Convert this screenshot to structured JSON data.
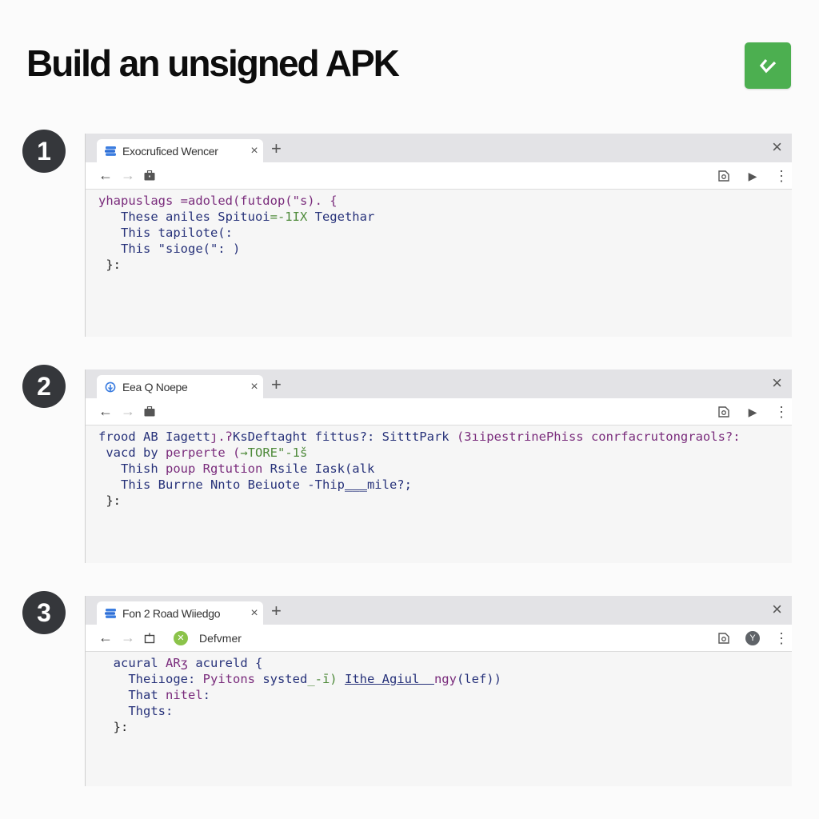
{
  "header": {
    "title": "Build an unsigned APK",
    "done_icon": "checkmark-icon",
    "accent_color": "#4caf50"
  },
  "steps": [
    {
      "number": "1",
      "tab": {
        "title": "Exocruficed Wencer",
        "favicon": "stack-icon"
      },
      "toolbar": {
        "right_icons": [
          "extension-icon",
          "play-icon",
          "kebab-menu-icon"
        ]
      },
      "code": [
        [
          {
            "t": "yhapuslags ",
            "c": "c-purple"
          },
          {
            "t": "=adoled(futdop(\"s). {",
            "c": "c-purple"
          }
        ],
        [
          {
            "t": "   These aniles Spituoi",
            "c": "c-blue"
          },
          {
            "t": "=-1IX",
            "c": "c-green"
          },
          {
            "t": " Tegethar",
            "c": "c-blue"
          }
        ],
        [
          {
            "t": "   This tapilote(:",
            "c": "c-blue"
          }
        ],
        [
          {
            "t": "   This \"sioge(\": )",
            "c": "c-blue"
          }
        ],
        [
          {
            "t": " }:",
            "c": "c-dark"
          }
        ]
      ]
    },
    {
      "number": "2",
      "tab": {
        "title": "Eea Q Noepe",
        "favicon": "globe-icon"
      },
      "toolbar": {
        "right_icons": [
          "extension-icon",
          "play-icon",
          "kebab-menu-icon"
        ]
      },
      "code": [
        [
          {
            "t": "frood AB ",
            "c": "c-blue"
          },
          {
            "t": "Iagett",
            "c": "c-blue"
          },
          {
            "t": "ȷ.ʔ",
            "c": "c-purple"
          },
          {
            "t": "KsDeftaght fittus?: SitttPark ",
            "c": "c-blue"
          },
          {
            "t": "(3ıipestrinePhiss conrfacrutongraols?:",
            "c": "c-purple"
          }
        ],
        [
          {
            "t": " vacd by ",
            "c": "c-blue"
          },
          {
            "t": "perperte (",
            "c": "c-purple"
          },
          {
            "t": "→TORE\"-1š",
            "c": "c-green"
          }
        ],
        [
          {
            "t": "   Thish ",
            "c": "c-blue"
          },
          {
            "t": "poup Rgtution",
            "c": "c-purple"
          },
          {
            "t": " Rsile Iask(alk",
            "c": "c-blue"
          }
        ],
        [
          {
            "t": "   This Burrne Nnto Beiuote -Thip",
            "c": "c-blue"
          },
          {
            "t": "___",
            "c": "c-link"
          },
          {
            "t": "mile?;",
            "c": "c-blue"
          }
        ],
        [
          {
            "t": " }:",
            "c": "c-dark"
          }
        ]
      ]
    },
    {
      "number": "3",
      "tab": {
        "title": "Fon 2 Road Wiiedgo",
        "favicon": "stack-icon"
      },
      "toolbar": {
        "site_label": "Defvmer",
        "site_icon": "puzzle-badge-icon",
        "right_icons": [
          "extension-icon",
          "profile-avatar-icon",
          "kebab-menu-icon"
        ]
      },
      "code": [
        [
          {
            "t": "  acural ",
            "c": "c-blue"
          },
          {
            "t": "ARʒ",
            "c": "c-purple"
          },
          {
            "t": " acureld {",
            "c": "c-blue"
          }
        ],
        [
          {
            "t": "    Theiıoge: ",
            "c": "c-blue"
          },
          {
            "t": "Pyitons",
            "c": "c-purple"
          },
          {
            "t": " systed",
            "c": "c-blue"
          },
          {
            "t": "_-ī)",
            "c": "c-green"
          },
          {
            "t": " ",
            "c": "c-blue"
          },
          {
            "t": "Ithe Agiul  ",
            "c": "c-link"
          },
          {
            "t": "ngy",
            "c": "c-purple"
          },
          {
            "t": "(lef))",
            "c": "c-blue"
          }
        ],
        [
          {
            "t": "    That ",
            "c": "c-blue"
          },
          {
            "t": "nitel",
            "c": "c-purple"
          },
          {
            "t": ":",
            "c": "c-blue"
          }
        ],
        [
          {
            "t": "    Thgts:",
            "c": "c-blue"
          }
        ],
        [
          {
            "t": "  }:",
            "c": "c-dark"
          }
        ]
      ]
    }
  ],
  "common": {
    "tab_close": "×",
    "new_tab": "+",
    "window_close": "×",
    "back": "←",
    "forward": "→",
    "kebab": "⋮",
    "play": "▶"
  }
}
